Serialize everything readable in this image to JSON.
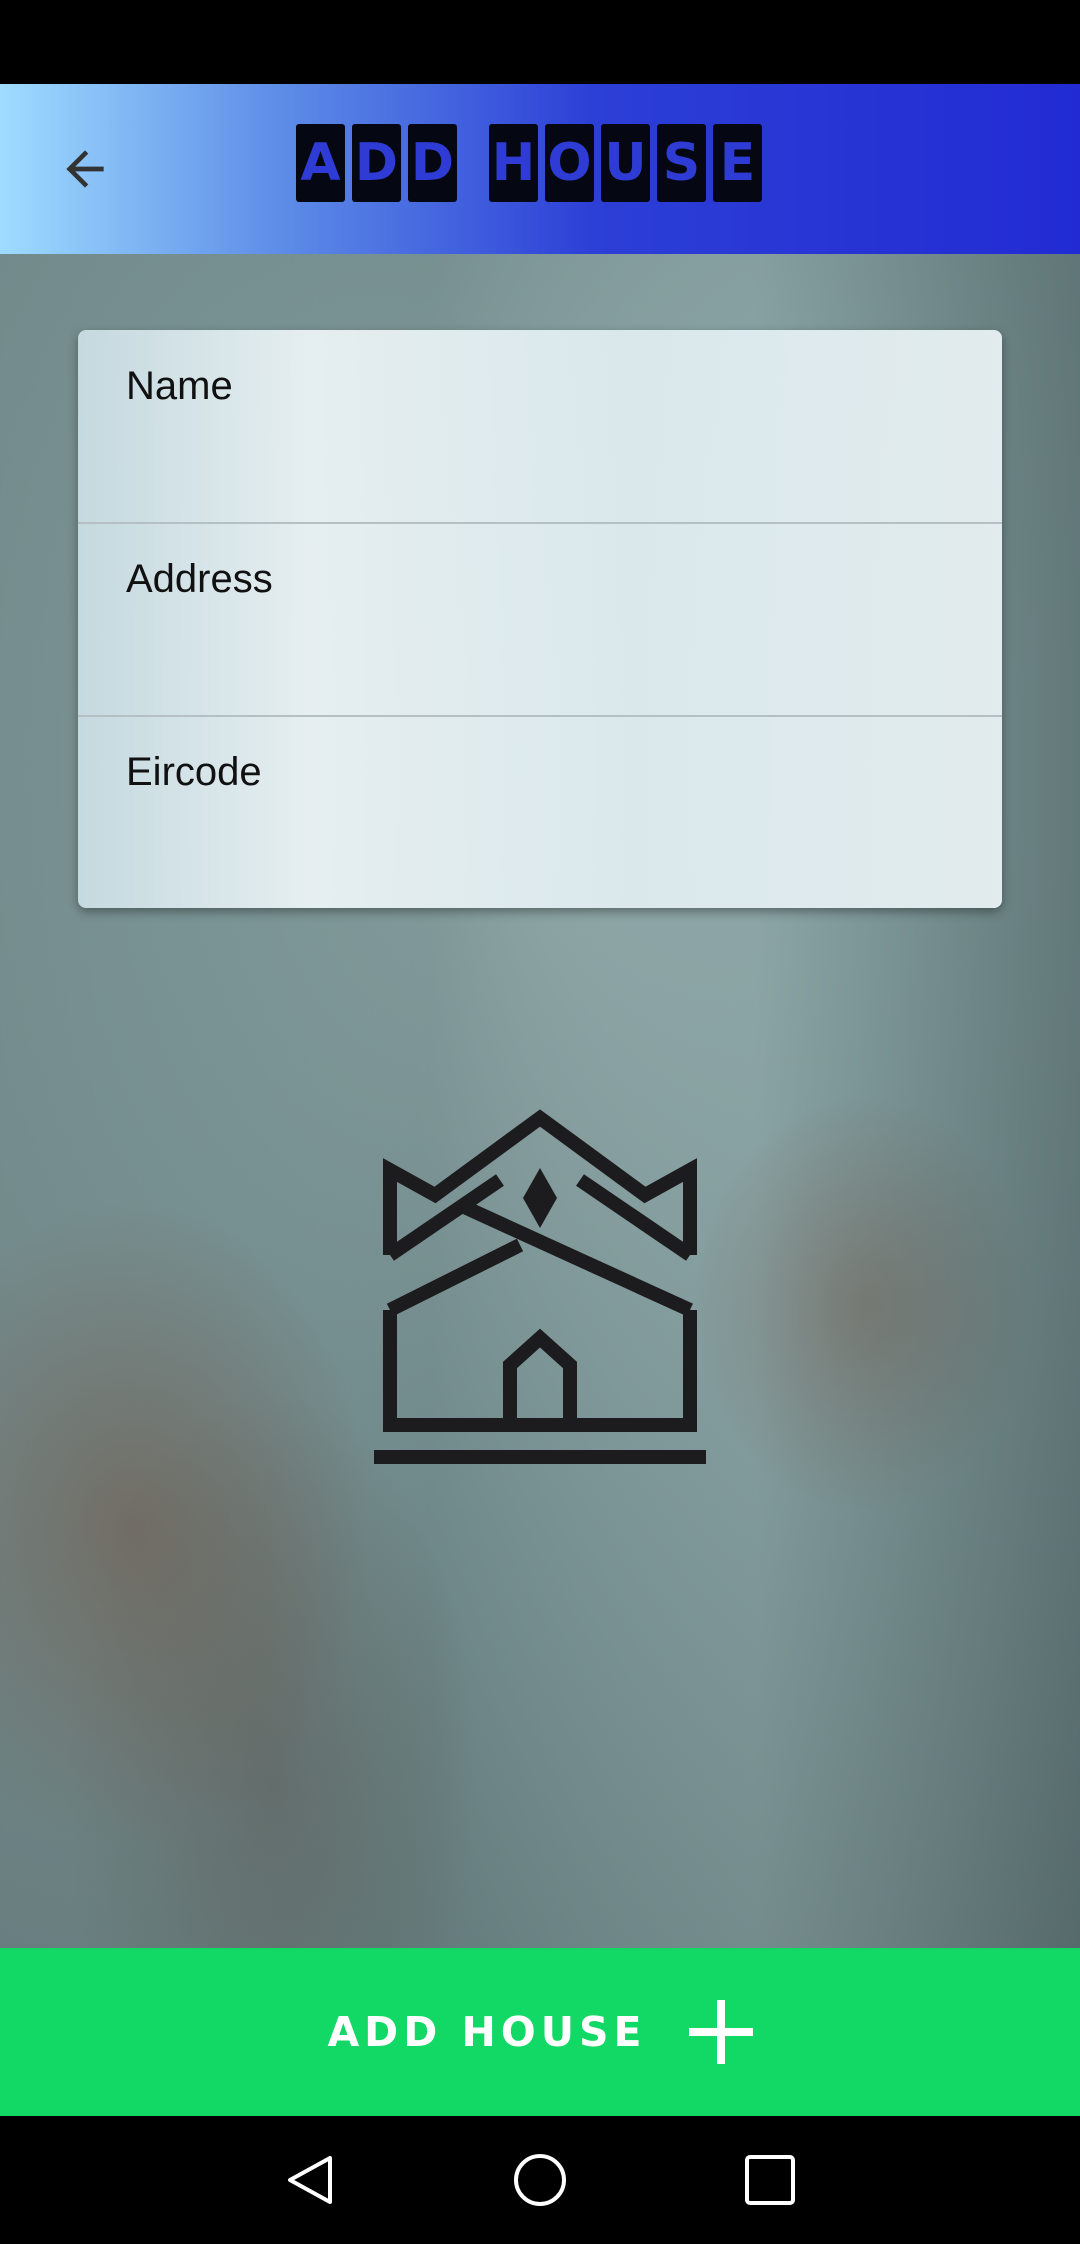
{
  "app_bar": {
    "back_icon": "arrow-left-icon",
    "title_letters": [
      "A",
      "D",
      "D",
      " ",
      "H",
      "O",
      "U",
      "S",
      "E"
    ]
  },
  "form": {
    "fields": [
      {
        "label": "Name",
        "value": ""
      },
      {
        "label": "Address",
        "value": ""
      },
      {
        "label": "Eircode",
        "value": ""
      }
    ]
  },
  "logo": {
    "icon": "house-logo-icon"
  },
  "primary_button": {
    "label": "ADD HOUSE",
    "icon": "plus-icon",
    "color": "#12d865"
  },
  "nav_bar": {
    "back_icon": "nav-back-icon",
    "home_icon": "nav-home-icon",
    "recents_icon": "nav-recents-icon"
  },
  "colors": {
    "app_bar_start": "#9fdcff",
    "app_bar_end": "#222bd3"
  }
}
